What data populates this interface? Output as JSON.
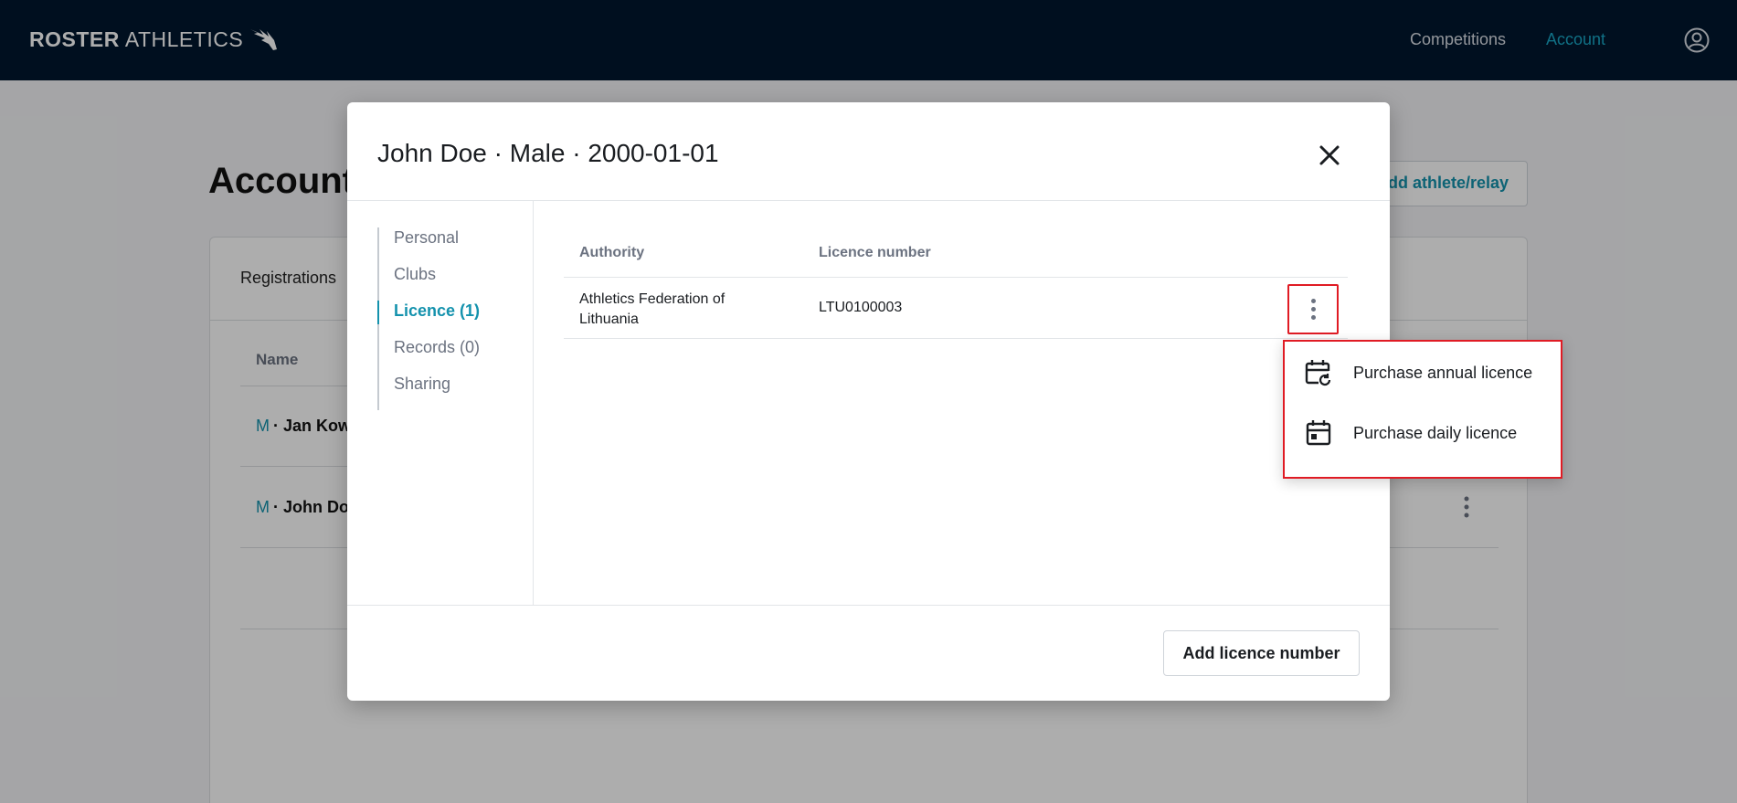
{
  "topbar": {
    "logo_strong": "ROSTER",
    "logo_light": "ATHLETICS",
    "nav": {
      "competitions": "Competitions",
      "account": "Account"
    }
  },
  "background": {
    "title": "Account",
    "add_button": "Add athlete/relay",
    "tab": "Registrations",
    "table_header_name": "Name",
    "rows": [
      {
        "gender": "M",
        "name": "· Jan Kow"
      },
      {
        "gender": "M",
        "name": "· John Do"
      }
    ]
  },
  "modal": {
    "title": "John Doe · Male · 2000-01-01",
    "side_nav": [
      {
        "label": "Personal",
        "active": false
      },
      {
        "label": "Clubs",
        "active": false
      },
      {
        "label": "Licence (1)",
        "active": true
      },
      {
        "label": "Records (0)",
        "active": false
      },
      {
        "label": "Sharing",
        "active": false
      }
    ],
    "table": {
      "headers": {
        "authority": "Authority",
        "licence_number": "Licence number"
      },
      "rows": [
        {
          "authority": "Athletics Federation of Lithuania",
          "licence_number": "LTU0100003"
        }
      ]
    },
    "add_licence_button": "Add licence number"
  },
  "menu": {
    "items": [
      {
        "label": "Purchase annual licence",
        "icon": "calendar-refresh-icon"
      },
      {
        "label": "Purchase daily licence",
        "icon": "calendar-today-icon"
      }
    ]
  },
  "colors": {
    "topbar": "#00172f",
    "accent": "#1492ad",
    "highlight_border": "#e01b24"
  }
}
